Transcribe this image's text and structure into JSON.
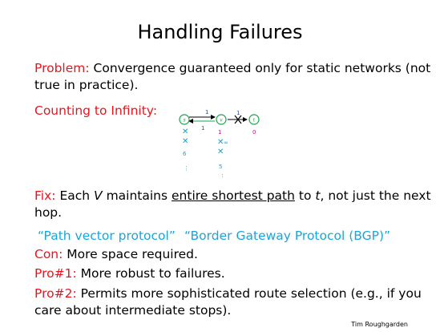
{
  "slide": {
    "title": "Handling Failures",
    "problem": {
      "label": "Problem:",
      "text1": "Convergence guaranteed only for static networks (not",
      "text2": "true in practice)."
    },
    "counting": {
      "label": "Counting to Infinity:"
    },
    "fix": {
      "label": "Fix:",
      "pre": "Each",
      "var_v": "V",
      "mid": "maintains",
      "underlined": "entire shortest path",
      "to": "to",
      "var_t": "t",
      "post": ", not just the next",
      "line2": "hop."
    },
    "quotes": {
      "q1": "“Path vector protocol”",
      "q2": "“Border Gateway Protocol (BGP)”"
    },
    "con": {
      "label": "Con:",
      "text": "More space required."
    },
    "pro1": {
      "label": "Pro#1:",
      "text": "More robust to failures."
    },
    "pro2": {
      "label": "Pro#2:",
      "text1": "Permits more sophisticated route selection (e.g., if you",
      "text2": "care about intermediate stops)."
    },
    "footer": "Tim Roughgarden"
  },
  "diagram": {
    "nodes": {
      "s": "s",
      "v": "v",
      "t": "t"
    },
    "edge_labels": {
      "sv_top": "1",
      "sv_bottom": "1",
      "vt": "1"
    },
    "s_column": {
      "dist": "6",
      "dots": "⋮"
    },
    "v_column": {
      "first": "1",
      "inf": "∞",
      "dist": "5",
      "dots": "⋮"
    },
    "t_column": {
      "dist": "0"
    },
    "colors": {
      "node": "#1aa34a",
      "label": "#1f4fa8",
      "value": "#1aa0c8",
      "magenta": "#c8107a"
    }
  }
}
